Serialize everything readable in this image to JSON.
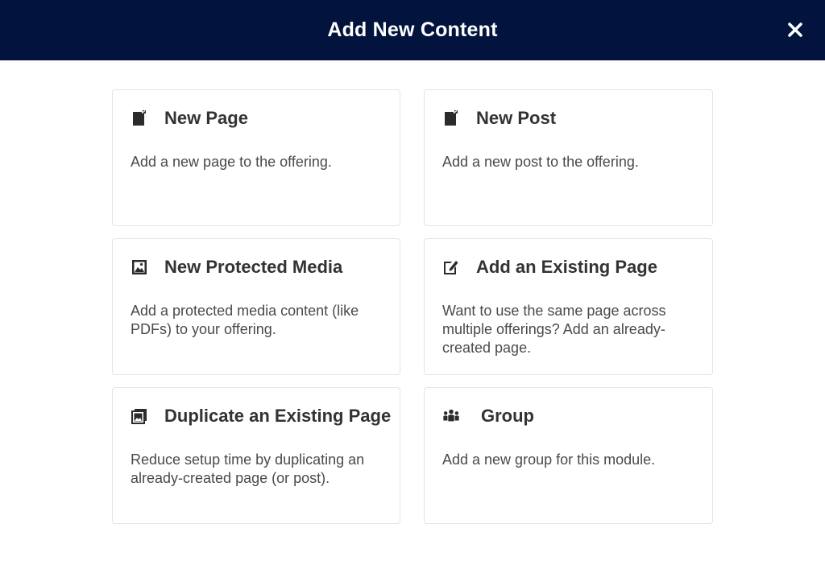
{
  "modal": {
    "title": "Add New Content",
    "close_icon": "close-icon",
    "header_color": "#02143d"
  },
  "cards": [
    {
      "title": "New Page",
      "description": "Add a new page to the offering.",
      "icon": "page-icon"
    },
    {
      "title": "New Post",
      "description": "Add a new post to the offering.",
      "icon": "post-icon"
    },
    {
      "title": "New Protected Media",
      "description": "Add a protected media content (like PDFs) to your offering.",
      "icon": "media-image-icon"
    },
    {
      "title": "Add an Existing Page",
      "description": "Want to use the same page across multiple offerings? Add an already-created page.",
      "icon": "edit-page-icon"
    },
    {
      "title": "Duplicate an Existing Page",
      "description": "Reduce setup time by duplicating an already-created page (or post).",
      "icon": "duplicate-page-icon"
    },
    {
      "title": "Group",
      "description": "Add a new group for this module.",
      "icon": "group-icon"
    }
  ]
}
